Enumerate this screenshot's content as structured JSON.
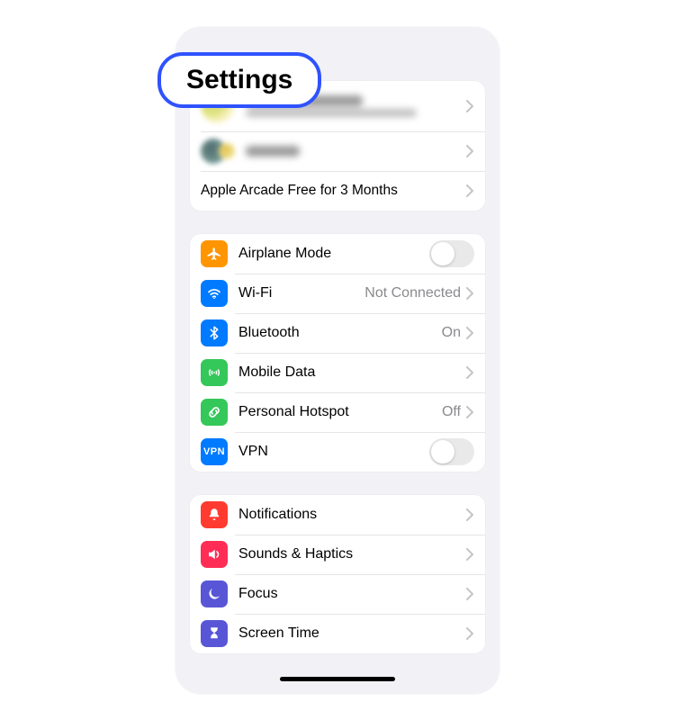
{
  "title": "Settings",
  "account": {
    "promo": "Apple Arcade Free for 3 Months"
  },
  "connectivity": {
    "airplane": {
      "label": "Airplane Mode",
      "color": "#ff9500"
    },
    "wifi": {
      "label": "Wi-Fi",
      "value": "Not Connected",
      "color": "#007aff"
    },
    "bluetooth": {
      "label": "Bluetooth",
      "value": "On",
      "color": "#007aff"
    },
    "mobile": {
      "label": "Mobile Data",
      "color": "#34c759"
    },
    "hotspot": {
      "label": "Personal Hotspot",
      "value": "Off",
      "color": "#34c759"
    },
    "vpn": {
      "label": "VPN",
      "text": "VPN",
      "color": "#007aff"
    }
  },
  "system": {
    "notifications": {
      "label": "Notifications",
      "color": "#ff3b30"
    },
    "sounds": {
      "label": "Sounds & Haptics",
      "color": "#ff2d55"
    },
    "focus": {
      "label": "Focus",
      "color": "#5856d6"
    },
    "screentime": {
      "label": "Screen Time",
      "color": "#5856d6"
    }
  }
}
